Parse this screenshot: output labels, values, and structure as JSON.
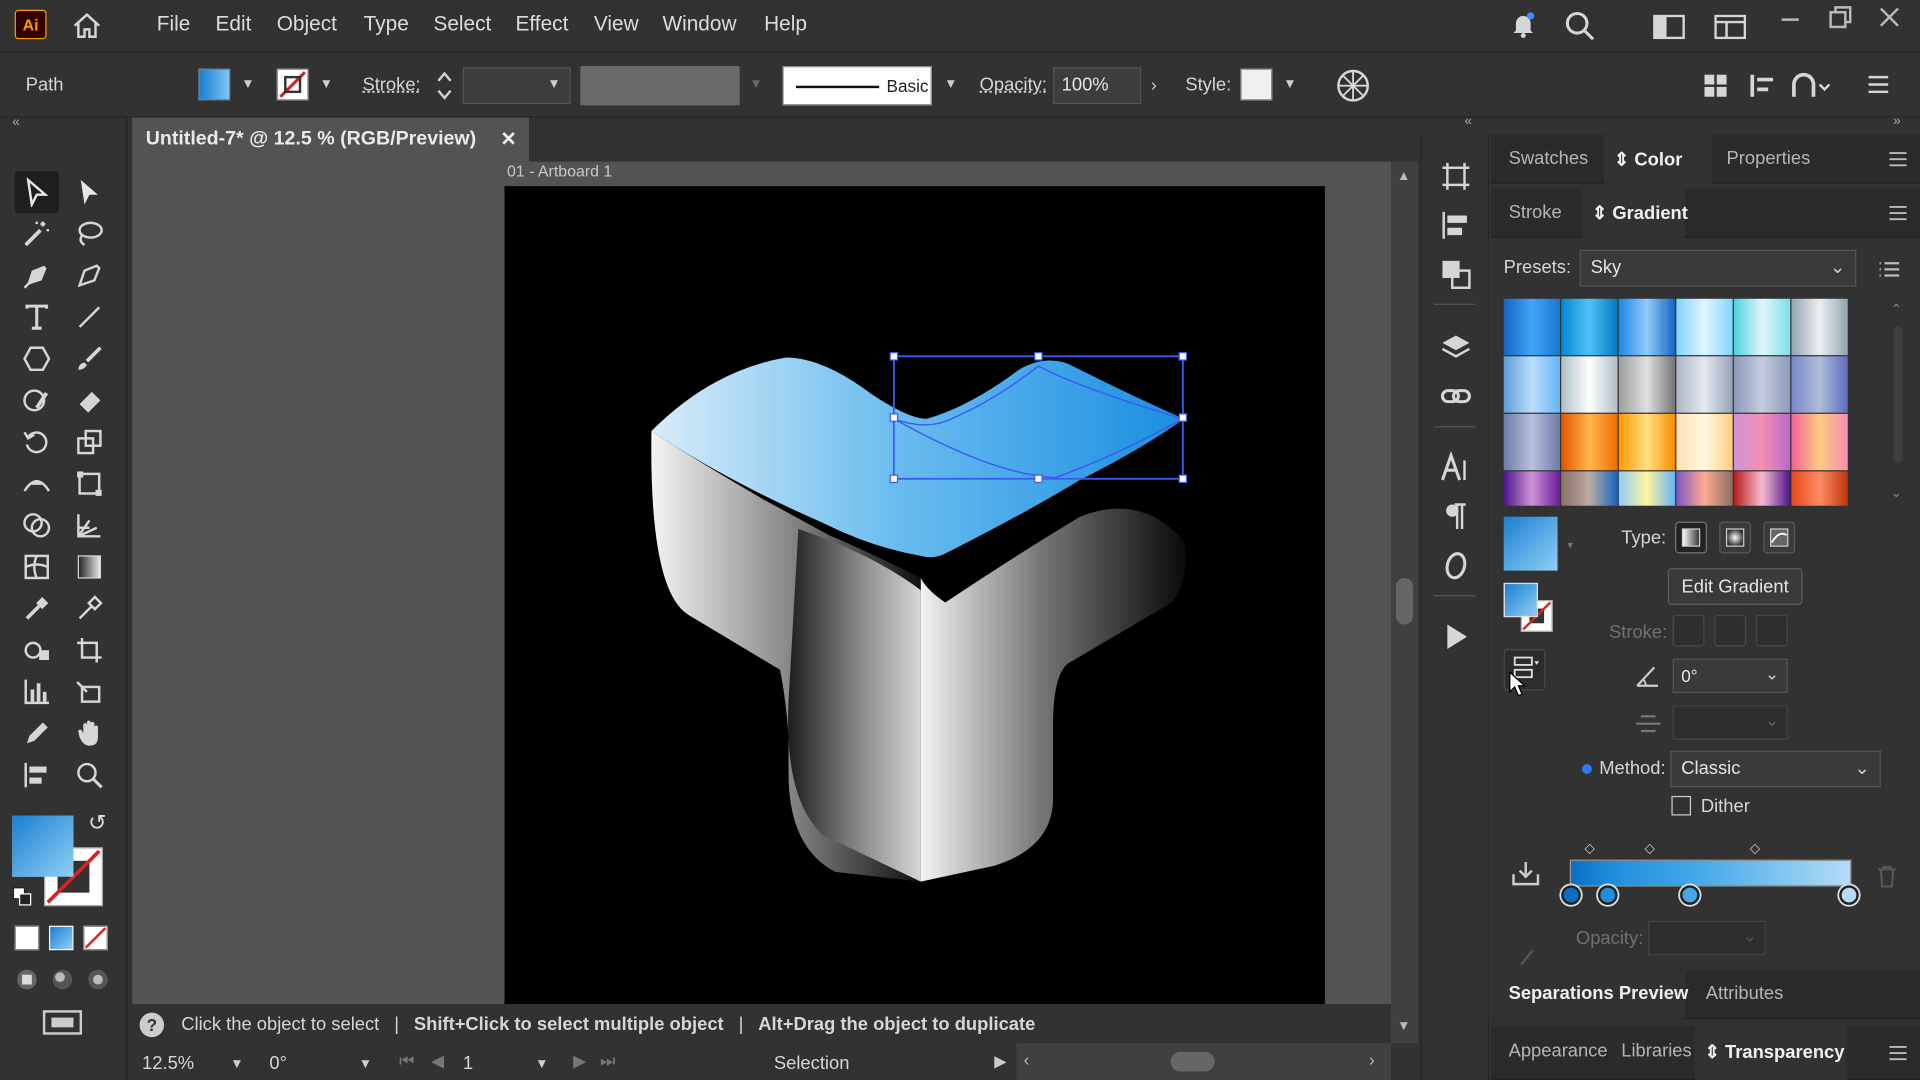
{
  "app": {
    "logo": "Ai"
  },
  "menu": [
    "File",
    "Edit",
    "Object",
    "Type",
    "Select",
    "Effect",
    "View",
    "Window",
    "Help"
  ],
  "control": {
    "selection_type": "Path",
    "stroke_label": "Stroke:",
    "brush_label": "Basic",
    "opacity_label": "Opacity:",
    "opacity_value": "100%",
    "style_label": "Style:"
  },
  "document": {
    "tab_title": "Untitled-7* @ 12.5 % (RGB/Preview)",
    "artboard_label": "01 - Artboard 1"
  },
  "status": {
    "hint_1": "Click the object to select",
    "hint_2": "Shift+Click to select multiple object",
    "hint_3": "Alt+Drag the object to duplicate",
    "zoom": "12.5%",
    "rotation": "0°",
    "artboard_number": "1",
    "tool_name": "Selection"
  },
  "panel": {
    "top_tabs": [
      "Swatches",
      "Color",
      "Properties"
    ],
    "mid_tabs": [
      "Stroke",
      "Gradient"
    ],
    "presets_label": "Presets:",
    "presets_value": "Sky",
    "type_label": "Type:",
    "edit_gradient": "Edit Gradient",
    "stroke_label": "Stroke:",
    "angle_value": "0°",
    "method_label": "Method:",
    "method_value": "Classic",
    "dither_label": "Dither",
    "opacity_label": "Opacity:",
    "bottom_tabs_1": [
      "Separations Preview",
      "Attributes"
    ],
    "bottom_tabs_2": [
      "Appearance",
      "Libraries",
      "Transparency"
    ]
  },
  "colors": {
    "accent_blue": "#2a9be0",
    "light_blue": "#a8d8f5",
    "selection": "#3a5cf0"
  }
}
